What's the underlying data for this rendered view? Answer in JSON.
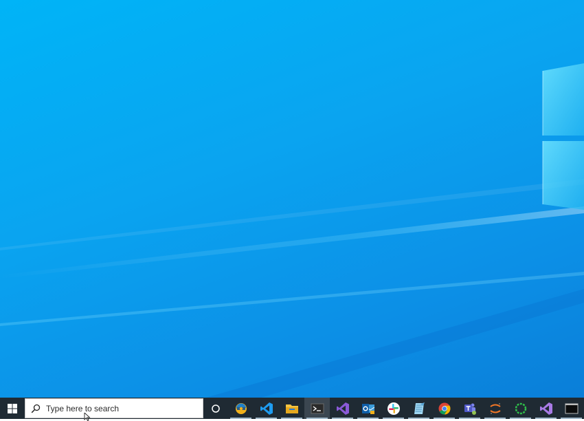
{
  "desktop": {
    "wallpaper": "windows-10-default-blue",
    "accent_color": "#0aa4f0"
  },
  "taskbar": {
    "background_color": "#1f2a33",
    "start_icon": "windows-logo-icon",
    "search": {
      "placeholder": "Type here to search",
      "icon": "search-icon"
    },
    "cortana_icon": "cortana-circle-icon",
    "apps": [
      {
        "name": "edge-canary",
        "icon": "edge-canary-icon",
        "running": true
      },
      {
        "name": "visual-studio-code",
        "icon": "vscode-icon",
        "running": true
      },
      {
        "name": "file-explorer",
        "icon": "folder-icon",
        "running": true
      },
      {
        "name": "terminal",
        "icon": "terminal-icon",
        "running": true,
        "active": true
      },
      {
        "name": "visual-studio",
        "icon": "visual-studio-icon",
        "running": true
      },
      {
        "name": "outlook",
        "icon": "outlook-icon",
        "running": true
      },
      {
        "name": "slack",
        "icon": "slack-icon",
        "running": true
      },
      {
        "name": "notepad-app",
        "icon": "notepad-icon",
        "running": true
      },
      {
        "name": "chrome",
        "icon": "chrome-icon",
        "running": true
      },
      {
        "name": "teams",
        "icon": "teams-icon",
        "running": true
      },
      {
        "name": "jupyter",
        "icon": "jupyter-icon",
        "running": true
      },
      {
        "name": "loading-app",
        "icon": "green-ring-icon",
        "running": true
      },
      {
        "name": "visual-studio-preview",
        "icon": "visual-studio-preview-icon",
        "running": true
      },
      {
        "name": "console-window",
        "icon": "console-window-icon",
        "running": true
      }
    ]
  }
}
